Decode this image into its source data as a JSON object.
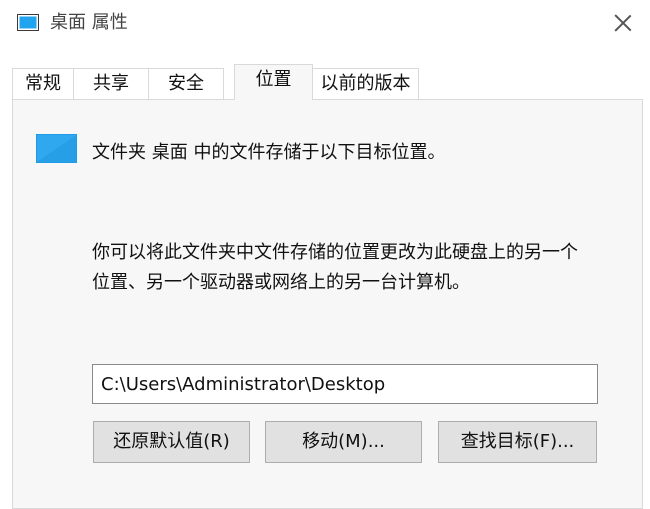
{
  "window": {
    "title": "桌面 属性",
    "icon": "folder-icon"
  },
  "tabs": [
    {
      "label": "常规",
      "active": false
    },
    {
      "label": "共享",
      "active": false
    },
    {
      "label": "安全",
      "active": false
    },
    {
      "label": "位置",
      "active": true
    },
    {
      "label": "以前的版本",
      "active": false
    }
  ],
  "location": {
    "info": "文件夹 桌面 中的文件存储于以下目标位置。",
    "description_line1": "你可以将此文件夹中文件存储的位置更改为此硬盘上的另一个",
    "description_line2": "位置、另一个驱动器或网络上的另一台计算机。",
    "path": "C:\\Users\\Administrator\\Desktop"
  },
  "buttons": {
    "restore_default": "还原默认值(R)",
    "move": "移动(M)...",
    "find_target": "查找目标(F)..."
  },
  "colors": {
    "accent": "#1e9be6",
    "panel": "#f7f7f7"
  }
}
